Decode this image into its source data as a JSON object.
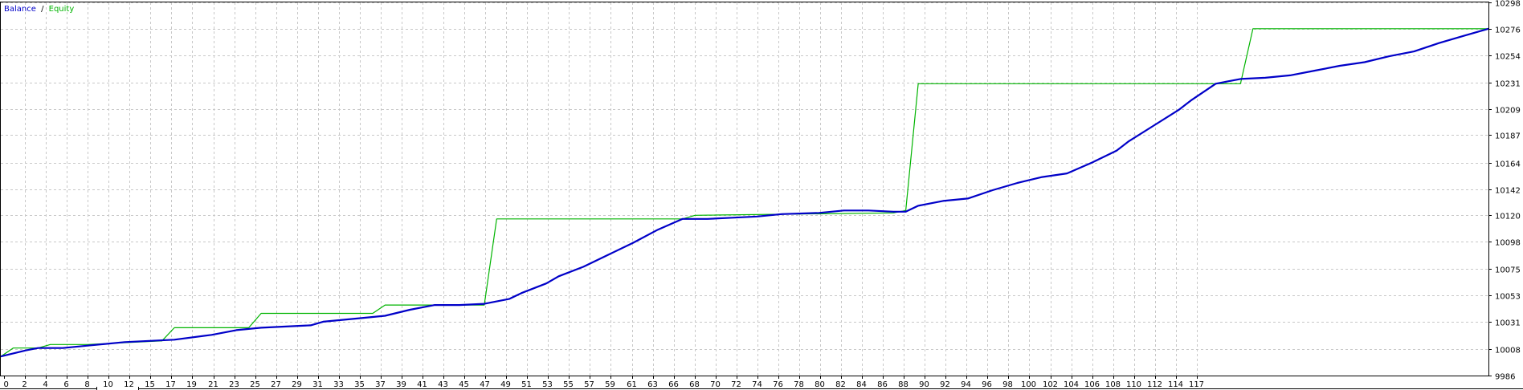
{
  "chart_data": {
    "type": "line",
    "title": "",
    "xlabel": "",
    "ylabel": "",
    "legend": {
      "position": "top-left",
      "entries": [
        {
          "label": "Balance",
          "color": "#0000c8"
        },
        {
          "label": "Equity",
          "color": "#00b400"
        }
      ],
      "separator": "/"
    },
    "grid": true,
    "x_ticks": [
      "0",
      "2",
      "4",
      "6",
      "8",
      "10",
      "12",
      "15",
      "17",
      "19",
      "21",
      "23",
      "25",
      "27",
      "29",
      "31",
      "33",
      "35",
      "37",
      "39",
      "41",
      "43",
      "45",
      "47",
      "49",
      "51",
      "53",
      "55",
      "57",
      "59",
      "61",
      "63",
      "66",
      "68",
      "70",
      "72",
      "74",
      "76",
      "78",
      "80",
      "82",
      "84",
      "86",
      "88",
      "90",
      "92",
      "94",
      "96",
      "98",
      "100",
      "102",
      "104",
      "106",
      "108",
      "110",
      "112",
      "114",
      "117"
    ],
    "y_ticks": [
      "9986",
      "10008",
      "10031",
      "10053",
      "10075",
      "10098",
      "10120",
      "10142",
      "10164",
      "10187",
      "10209",
      "10231",
      "10254",
      "10276",
      "10298"
    ],
    "xlim": [
      0,
      120
    ],
    "ylim": [
      9986,
      10298
    ],
    "series": [
      {
        "name": "Balance",
        "color": "#0000c8",
        "points": [
          [
            0,
            10002
          ],
          [
            2,
            10007
          ],
          [
            3,
            10009
          ],
          [
            5,
            10009
          ],
          [
            7,
            10011
          ],
          [
            10,
            10014
          ],
          [
            12,
            10015
          ],
          [
            14,
            10016
          ],
          [
            17,
            10020
          ],
          [
            19,
            10024
          ],
          [
            21,
            10026
          ],
          [
            23,
            10027
          ],
          [
            25,
            10028
          ],
          [
            26,
            10031
          ],
          [
            29,
            10034
          ],
          [
            31,
            10036
          ],
          [
            33,
            10041
          ],
          [
            35,
            10045
          ],
          [
            37,
            10045
          ],
          [
            39,
            10046
          ],
          [
            41,
            10050
          ],
          [
            42,
            10055
          ],
          [
            44,
            10063
          ],
          [
            45,
            10069
          ],
          [
            47,
            10077
          ],
          [
            49,
            10087
          ],
          [
            51,
            10097
          ],
          [
            53,
            10108
          ],
          [
            55,
            10117
          ],
          [
            57,
            10117
          ],
          [
            59,
            10118
          ],
          [
            61,
            10119
          ],
          [
            63,
            10121
          ],
          [
            66,
            10122
          ],
          [
            68,
            10124
          ],
          [
            70,
            10124
          ],
          [
            72,
            10123
          ],
          [
            73,
            10123
          ],
          [
            74,
            10128
          ],
          [
            76,
            10132
          ],
          [
            78,
            10134
          ],
          [
            80,
            10141
          ],
          [
            82,
            10147
          ],
          [
            84,
            10152
          ],
          [
            86,
            10155
          ],
          [
            88,
            10164
          ],
          [
            90,
            10174
          ],
          [
            91,
            10182
          ],
          [
            93,
            10195
          ],
          [
            95,
            10208
          ],
          [
            96,
            10216
          ],
          [
            98,
            10230
          ],
          [
            100,
            10234
          ],
          [
            102,
            10235
          ],
          [
            104,
            10237
          ],
          [
            106,
            10241
          ],
          [
            108,
            10245
          ],
          [
            110,
            10248
          ],
          [
            112,
            10253
          ],
          [
            114,
            10257
          ],
          [
            116,
            10264
          ],
          [
            118,
            10270
          ],
          [
            120,
            10276
          ]
        ]
      },
      {
        "name": "Equity",
        "color": "#00b400",
        "points": [
          [
            0,
            10002
          ],
          [
            1,
            10009
          ],
          [
            3,
            10009
          ],
          [
            4,
            10012
          ],
          [
            7,
            10012
          ],
          [
            13,
            10015
          ],
          [
            14,
            10026
          ],
          [
            20,
            10026
          ],
          [
            21,
            10038
          ],
          [
            30,
            10038
          ],
          [
            31,
            10045
          ],
          [
            39,
            10045
          ],
          [
            40,
            10117
          ],
          [
            55,
            10117
          ],
          [
            56,
            10120
          ],
          [
            72,
            10122
          ],
          [
            73,
            10124
          ],
          [
            74,
            10230
          ],
          [
            100,
            10230
          ],
          [
            101,
            10276
          ],
          [
            120,
            10276
          ]
        ]
      }
    ]
  }
}
